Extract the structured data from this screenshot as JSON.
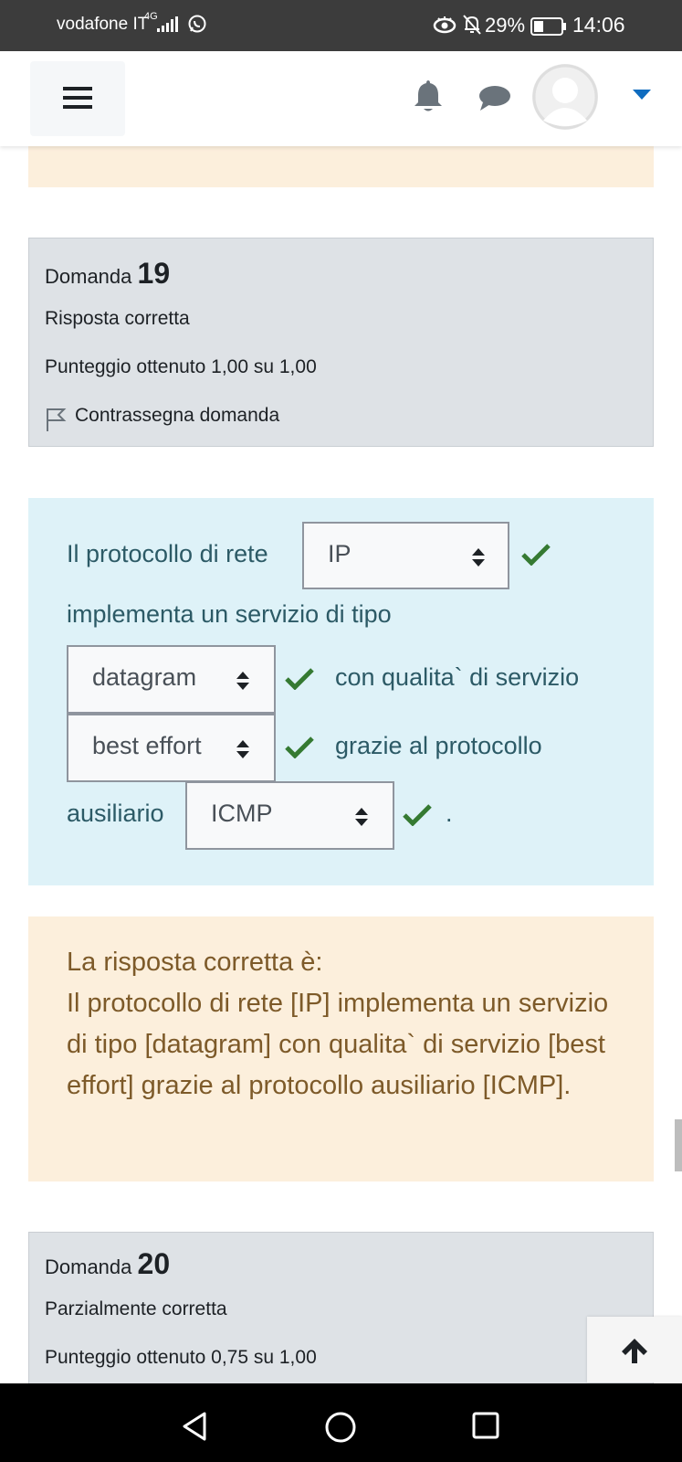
{
  "status_bar": {
    "carrier": "vodafone IT",
    "network": "4G",
    "battery_percent": "29%",
    "time": "14:06",
    "icons": [
      "signal-icon",
      "whatsapp-icon",
      "eye-icon",
      "bell-off-icon",
      "battery-icon"
    ]
  },
  "navbar": {
    "icons": [
      "hamburger-menu-icon",
      "notification-bell-icon",
      "messages-icon",
      "user-avatar",
      "caret-down-icon"
    ],
    "accent_color": "#0f6cbf"
  },
  "question19": {
    "label": "Domanda",
    "number": "19",
    "state": "Risposta corretta",
    "grade": "Punteggio ottenuto 1,00 su 1,00",
    "flag_label": "Contrassegna domanda"
  },
  "question_text": {
    "part1": "Il protocollo di rete",
    "part2": "implementa un servizio di tipo",
    "part3": "con qualita` di servizio",
    "part4": "grazie al protocollo",
    "part5": "ausiliario",
    "part6": ".",
    "selects": {
      "s1": "IP",
      "s2": "datagram",
      "s3": "best effort",
      "s4": "ICMP"
    },
    "check_color": "#357a32"
  },
  "feedback": {
    "heading": "La risposta corretta è:",
    "body": "Il protocollo di rete [IP] implementa un servizio di tipo [datagram] con qualita` di servizio [best effort] grazie al protocollo ausiliario [ICMP]."
  },
  "question20": {
    "label": "Domanda",
    "number": "20",
    "state": "Parzialmente corretta",
    "grade": "Punteggio ottenuto 0,75 su 1,00"
  },
  "colors": {
    "info_bg": "#dee2e6",
    "question_bg": "#def2f8",
    "feedback_bg": "#fcefdc",
    "feedback_text": "#7d5a29",
    "question_text": "#2c5a66"
  }
}
